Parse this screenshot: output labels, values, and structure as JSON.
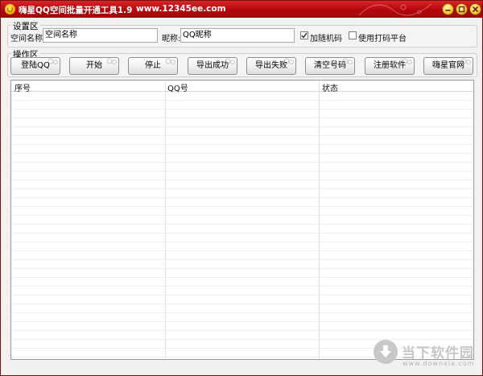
{
  "window": {
    "title": "嗨星QQ空间批量开通工具1.9",
    "url": "www.12345ee.com"
  },
  "settings": {
    "group_label": "设置区",
    "space_name_label": "空间名称:",
    "space_name_value": "空间名称",
    "nickname_label": "昵称:",
    "nickname_value": "QQ昵称",
    "add_random_code": {
      "label": "加随机码",
      "checked": true
    },
    "use_captcha_platform": {
      "label": "使用打码平台",
      "checked": false
    }
  },
  "operations": {
    "group_label": "操作区",
    "buttons": [
      {
        "label": "登陆QQ"
      },
      {
        "label": "开始"
      },
      {
        "label": "停止"
      },
      {
        "label": "导出成功"
      },
      {
        "label": "导出失败"
      },
      {
        "label": "清空号码"
      },
      {
        "label": "注册软件"
      },
      {
        "label": "嗨星官网"
      }
    ]
  },
  "table": {
    "columns": [
      "序号",
      "QQ号",
      "状态"
    ]
  },
  "watermark": {
    "text": "当下软件园",
    "url": "www.downxia.com"
  }
}
